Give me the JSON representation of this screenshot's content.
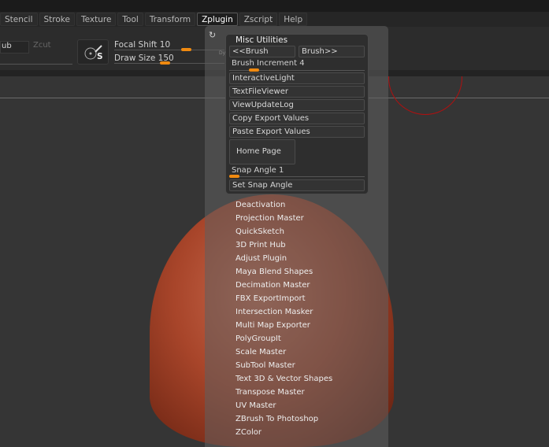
{
  "menubar": [
    "Stencil",
    "Stroke",
    "Texture",
    "Tool",
    "Transform",
    "Zplugin",
    "Zscript",
    "Help"
  ],
  "active_menu": "Zplugin",
  "toolbar": {
    "zsub_partial": "ub",
    "zcut": "Zcut",
    "focal_shift_label": "Focal Shift",
    "focal_shift": "10",
    "draw_size_label": "Draw Size",
    "draw_size": "150",
    "dyn_partial": "Dy",
    "brush_badge": "S"
  },
  "misc": {
    "title": "Misc Utilities",
    "prev_brush": "<<Brush",
    "next_brush": "Brush>>",
    "brush_increment_label": "Brush Increment",
    "brush_increment": "4",
    "buttons": [
      "InteractiveLight",
      "TextFileViewer",
      "ViewUpdateLog",
      "Copy Export Values",
      "Paste Export Values"
    ],
    "home_page": "Home Page",
    "snap_angle_label": "Snap Angle",
    "snap_angle": "1",
    "set_snap_angle": "Set Snap Angle"
  },
  "plugins": [
    "Deactivation",
    "Projection Master",
    "QuickSketch",
    "3D Print Hub",
    "Adjust Plugin",
    "Maya Blend Shapes",
    "Decimation Master",
    "FBX ExportImport",
    "Intersection Masker",
    "Multi Map Exporter",
    "PolyGroupIt",
    "Scale Master",
    "SubTool Master",
    "Text 3D & Vector Shapes",
    "Transpose Master",
    "UV Master",
    "ZBrush To Photoshop",
    "ZColor"
  ],
  "colors": {
    "accent": "#f08a10",
    "model": "#a8452a"
  }
}
